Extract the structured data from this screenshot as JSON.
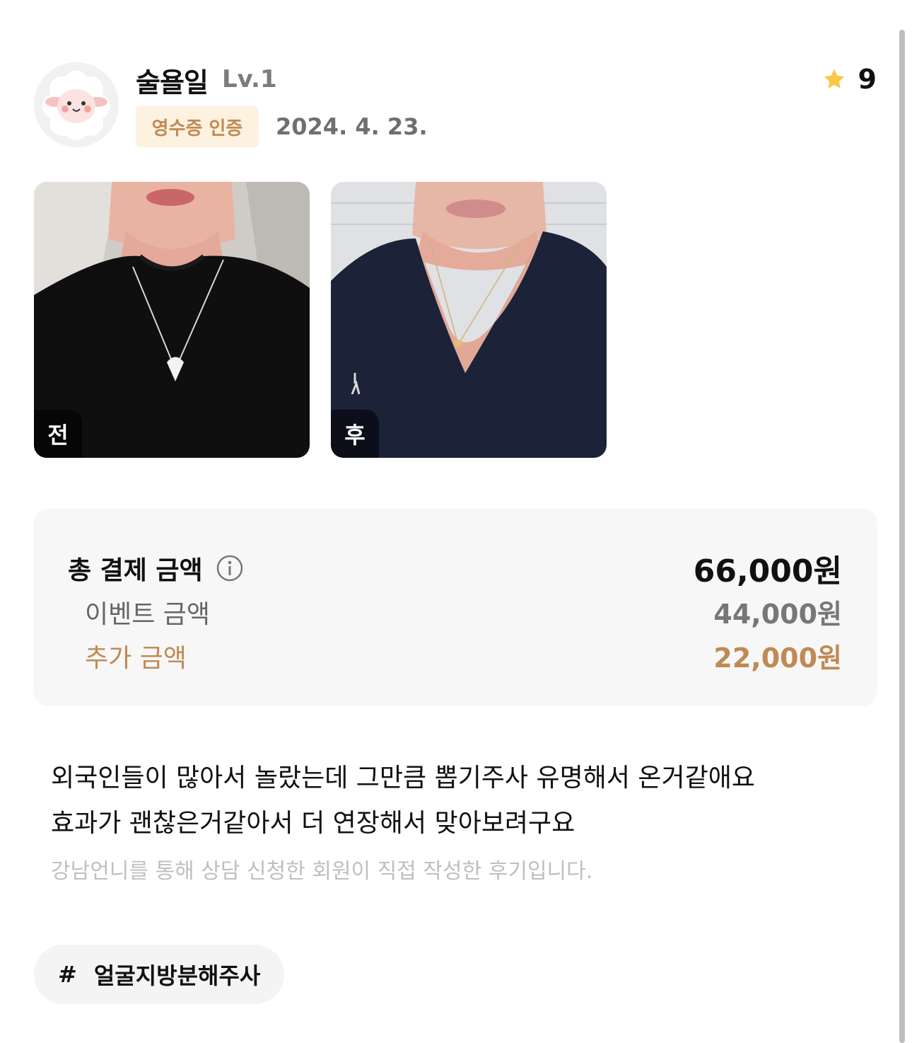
{
  "user": {
    "name": "술욜일",
    "level": "Lv.1",
    "badge": "영수증 인증",
    "date": "2024. 4. 23."
  },
  "rating": {
    "value": "9",
    "icon": "star-icon"
  },
  "photos": [
    {
      "label": "전",
      "shirt_color": "#0f0f0f",
      "bg_color": "#cfccc8"
    },
    {
      "label": "후",
      "shirt_color": "#1c2238",
      "bg_color": "#dfe1e4"
    }
  ],
  "price": {
    "total_label": "총 결제 금액",
    "total_value": "66,000원",
    "event_label": "이벤트 금액",
    "event_value": "44,000원",
    "extra_label": "추가 금액",
    "extra_value": "22,000원"
  },
  "review": {
    "line1": "외국인들이 많아서 놀랐는데 그만큼 뽑기주사 유명해서 온거같애요",
    "line2": "효과가 괜찮은거같아서 더 연장해서 맞아보려구요",
    "disclaimer": "강남언니를 통해 상담 신청한 회원이 직접 작성한 후기입니다."
  },
  "tag": {
    "hash": "#",
    "label": "얼굴지방분해주사"
  },
  "colors": {
    "accent": "#c08a52",
    "star": "#f7c948",
    "badge_bg": "#fdf1e0"
  }
}
